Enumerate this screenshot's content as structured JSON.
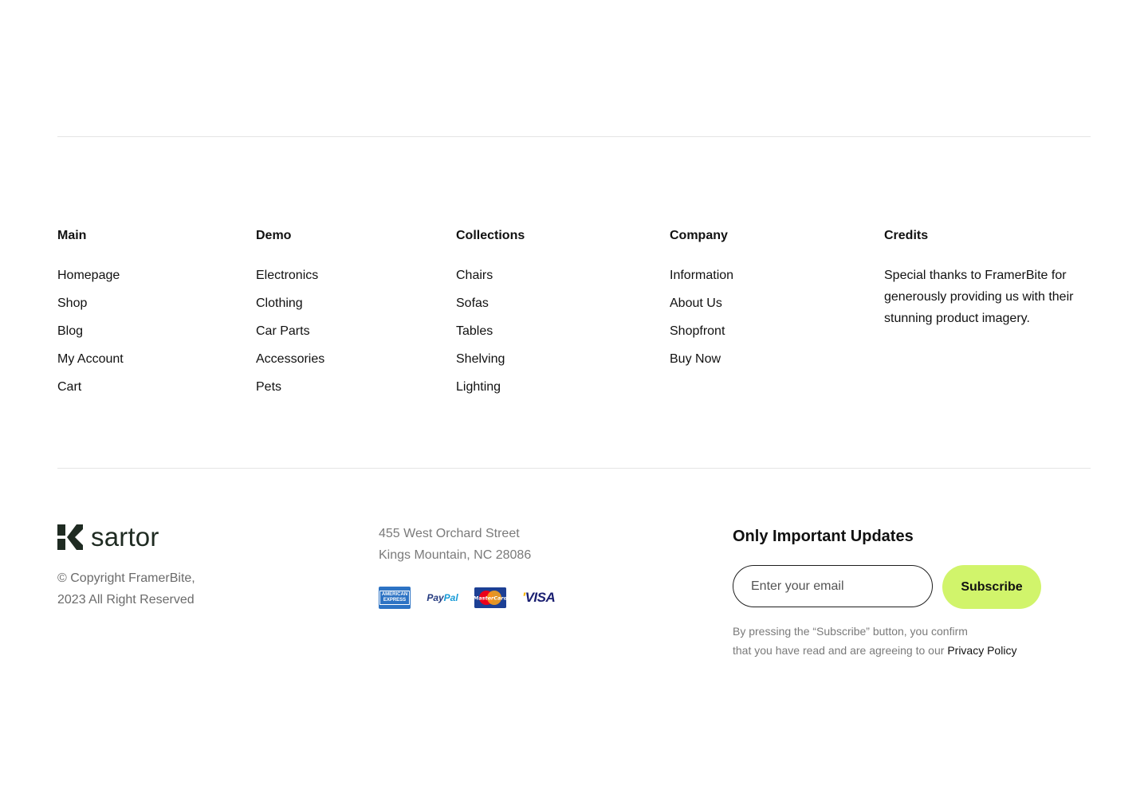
{
  "footer": {
    "columns": [
      {
        "title": "Main",
        "links": [
          "Homepage",
          "Shop",
          "Blog",
          "My Account",
          "Cart"
        ]
      },
      {
        "title": "Demo",
        "links": [
          "Electronics",
          "Clothing",
          "Car Parts",
          "Accessories",
          "Pets"
        ]
      },
      {
        "title": "Collections",
        "links": [
          "Chairs",
          "Sofas",
          "Tables",
          "Shelving",
          "Lighting"
        ]
      },
      {
        "title": "Company",
        "links": [
          "Information",
          "About Us",
          "Shopfront",
          "Buy Now"
        ]
      }
    ],
    "credits": {
      "title": "Credits",
      "text": "Special thanks to FramerBite for generously providing us with their stunning product imagery."
    }
  },
  "brand": {
    "logo_text": "sartor",
    "copyright_line1": "© Copyright FramerBite,",
    "copyright_line2": "2023 All Right Reserved"
  },
  "address": {
    "line1": "455 West Orchard Street",
    "line2": "Kings Mountain, NC 28086"
  },
  "payments": {
    "amex_line1": "AMERICAN",
    "amex_line2": "EXPRESS",
    "paypal_part1": "Pay",
    "paypal_part2": "Pal",
    "mastercard": "MasterCard",
    "visa": "VISA"
  },
  "newsletter": {
    "title": "Only Important Updates",
    "email_placeholder": "Enter your email",
    "subscribe_label": "Subscribe",
    "disclaimer_line1": "By pressing the “Subscribe” button, you confirm",
    "disclaimer_line2": "that you have read and are agreeing to our",
    "privacy_link": "Privacy Policy"
  },
  "colors": {
    "accent": "#d1f46b",
    "logo": "#1f2b22",
    "divider": "#e4e4e4",
    "muted_text": "#7a7a7a"
  }
}
